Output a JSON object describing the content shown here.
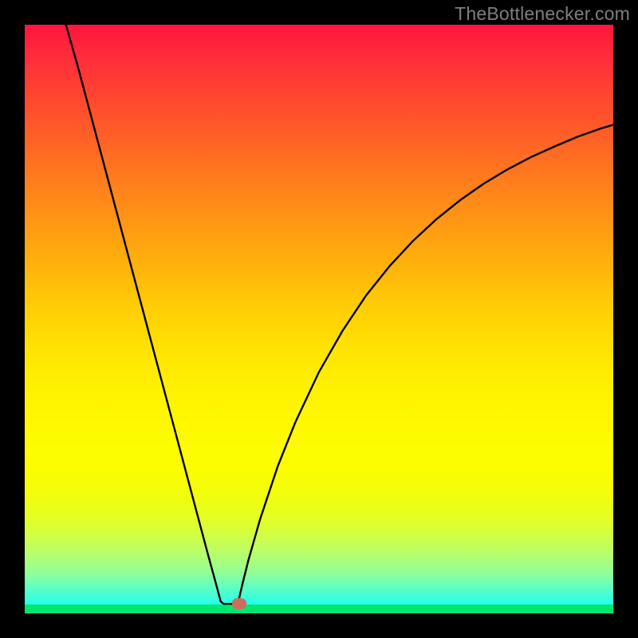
{
  "watermark": "TheBottlenecker.com",
  "chart_data": {
    "type": "line",
    "title": "",
    "xlabel": "",
    "ylabel": "",
    "xlim": [
      0,
      100
    ],
    "ylim": [
      0,
      100
    ],
    "gradient_note": "background is vertical rainbow gradient red→yellow→green",
    "curve_points": [
      {
        "x": 7.0,
        "y": 100.0
      },
      {
        "x": 9.0,
        "y": 93.0
      },
      {
        "x": 11.0,
        "y": 85.5
      },
      {
        "x": 13.0,
        "y": 78.0
      },
      {
        "x": 15.0,
        "y": 70.5
      },
      {
        "x": 17.0,
        "y": 63.0
      },
      {
        "x": 19.0,
        "y": 55.5
      },
      {
        "x": 21.0,
        "y": 48.0
      },
      {
        "x": 23.0,
        "y": 40.5
      },
      {
        "x": 25.0,
        "y": 33.0
      },
      {
        "x": 27.0,
        "y": 25.5
      },
      {
        "x": 29.0,
        "y": 18.0
      },
      {
        "x": 31.0,
        "y": 10.5
      },
      {
        "x": 32.5,
        "y": 5.0
      },
      {
        "x": 33.3,
        "y": 2.0
      },
      {
        "x": 33.8,
        "y": 1.6
      },
      {
        "x": 35.8,
        "y": 1.6
      },
      {
        "x": 36.3,
        "y": 2.0
      },
      {
        "x": 37.0,
        "y": 5.0
      },
      {
        "x": 38.0,
        "y": 9.0
      },
      {
        "x": 40.0,
        "y": 16.0
      },
      {
        "x": 43.0,
        "y": 25.0
      },
      {
        "x": 46.0,
        "y": 32.5
      },
      {
        "x": 50.0,
        "y": 41.0
      },
      {
        "x": 54.0,
        "y": 48.0
      },
      {
        "x": 58.0,
        "y": 54.0
      },
      {
        "x": 62.0,
        "y": 59.0
      },
      {
        "x": 66.0,
        "y": 63.3
      },
      {
        "x": 70.0,
        "y": 67.0
      },
      {
        "x": 74.0,
        "y": 70.2
      },
      {
        "x": 78.0,
        "y": 73.0
      },
      {
        "x": 82.0,
        "y": 75.4
      },
      {
        "x": 86.0,
        "y": 77.5
      },
      {
        "x": 90.0,
        "y": 79.3
      },
      {
        "x": 94.0,
        "y": 81.0
      },
      {
        "x": 98.0,
        "y": 82.4
      },
      {
        "x": 100.0,
        "y": 83.0
      }
    ],
    "marker": {
      "x": 36.5,
      "y": 1.6
    },
    "green_baseline_y": 1.5
  }
}
